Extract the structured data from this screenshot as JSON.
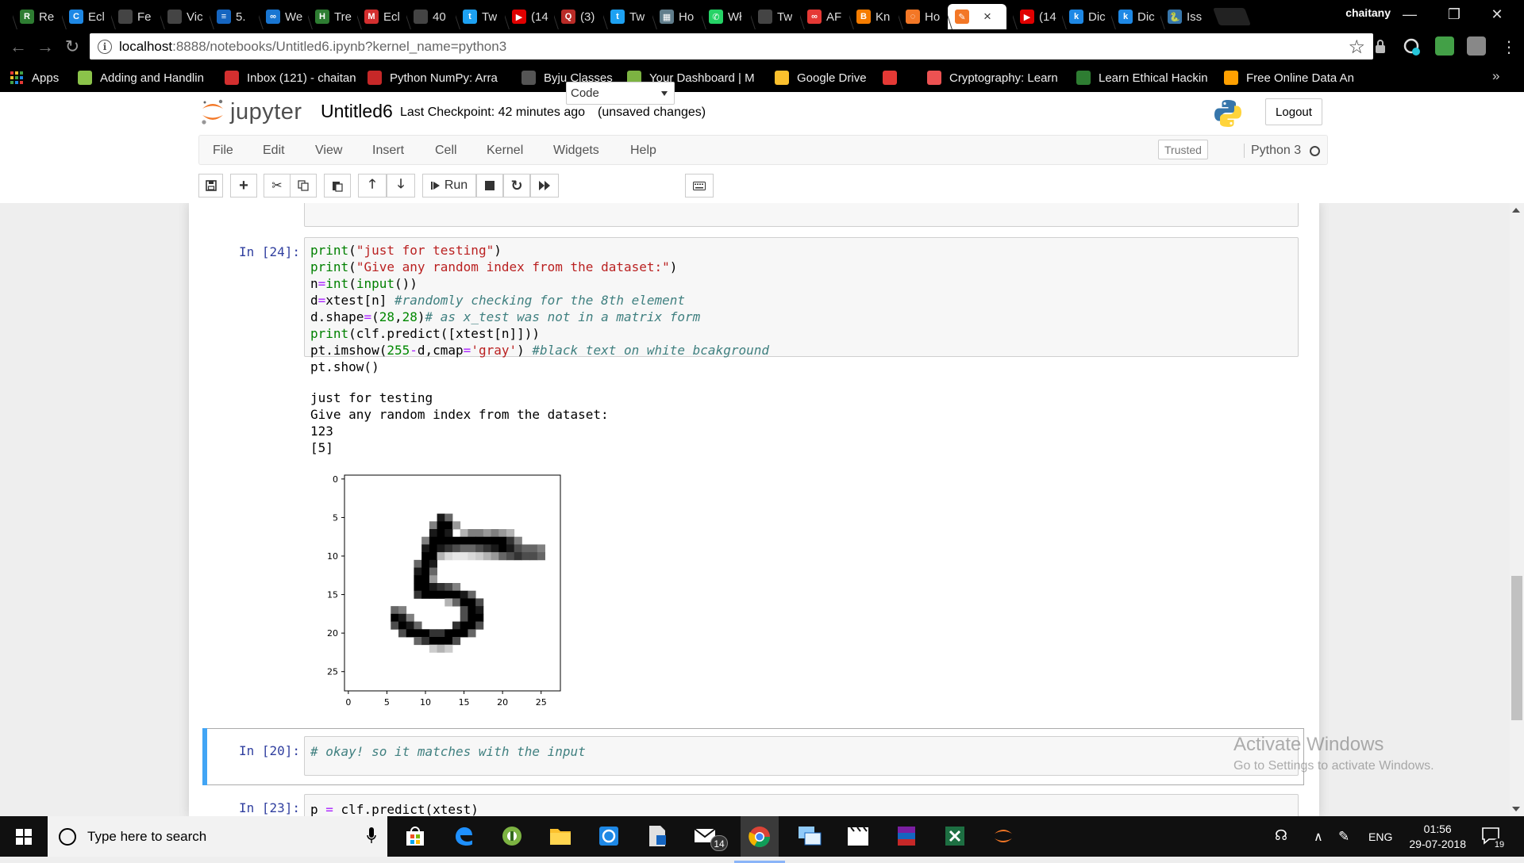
{
  "browser": {
    "tabs": [
      {
        "label": "Re",
        "color": "#2e7d32",
        "glyph": "R"
      },
      {
        "label": "Ecl",
        "color": "#1e88e5",
        "glyph": "C"
      },
      {
        "label": "Fe",
        "color": "#444444",
        "glyph": ""
      },
      {
        "label": "Vic",
        "color": "#444444",
        "glyph": ""
      },
      {
        "label": "5.",
        "color": "#1565c0",
        "glyph": "≡"
      },
      {
        "label": "We",
        "color": "#1976d2",
        "glyph": "∞"
      },
      {
        "label": "Tre",
        "color": "#2e7d32",
        "glyph": "H"
      },
      {
        "label": "Ecl",
        "color": "#d32f2f",
        "glyph": "M"
      },
      {
        "label": "40",
        "color": "#444444",
        "glyph": ""
      },
      {
        "label": "Tw",
        "color": "#1da1f2",
        "glyph": "t"
      },
      {
        "label": "(14",
        "color": "#e00000",
        "glyph": "▶"
      },
      {
        "label": "(3)",
        "color": "#b92b27",
        "glyph": "Q"
      },
      {
        "label": "Tw",
        "color": "#1da1f2",
        "glyph": "t"
      },
      {
        "label": "Ho",
        "color": "#607d8b",
        "glyph": "▦"
      },
      {
        "label": "Wł",
        "color": "#25d366",
        "glyph": "✆"
      },
      {
        "label": "Tw",
        "color": "#444444",
        "glyph": ""
      },
      {
        "label": "AF",
        "color": "#e53935",
        "glyph": "∞"
      },
      {
        "label": "Kn",
        "color": "#f57c00",
        "glyph": "B"
      },
      {
        "label": "Ho",
        "color": "#f37726",
        "glyph": "◌"
      },
      {
        "label": "",
        "color": "#f37726",
        "glyph": "✎",
        "active": true
      },
      {
        "label": "(14",
        "color": "#e00000",
        "glyph": "▶"
      },
      {
        "label": "Dic",
        "color": "#1e88e5",
        "glyph": "k"
      },
      {
        "label": "Dic",
        "color": "#1e88e5",
        "glyph": "k"
      },
      {
        "label": "Iss",
        "color": "#3776ab",
        "glyph": "🐍"
      }
    ],
    "profile_name": "chaitany",
    "url_host": "localhost",
    "url_path": ":8888/notebooks/Untitled6.ipynb?kernel_name=python3",
    "bookmarks": [
      {
        "label": "Apps",
        "icon": "apps-grid-icon",
        "color": "#e53935"
      },
      {
        "label": "Adding and Handlin",
        "icon": "android-icon",
        "color": "#8bc34a"
      },
      {
        "label": "Inbox (121) - chaitan",
        "icon": "gmail-icon",
        "color": "#d32f2f"
      },
      {
        "label": "Python NumPy: Arra",
        "icon": "w3-icon",
        "color": "#c62828"
      },
      {
        "label": "Byju Classes",
        "icon": "byju-icon",
        "color": "#555555"
      },
      {
        "label": "Your Dashboard | M",
        "icon": "dashboard-icon",
        "color": "#7cb342"
      },
      {
        "label": "Google Drive",
        "icon": "drive-icon",
        "color": "#fbc02d"
      },
      {
        "label": "",
        "icon": "bookmark-icon",
        "color": "#e53935"
      },
      {
        "label": "Cryptography: Learn",
        "icon": "udemy-icon",
        "color": "#ec5252"
      },
      {
        "label": "Learn Ethical Hackin",
        "icon": "ftu-icon",
        "color": "#2e7d32"
      },
      {
        "label": "Free Online Data An",
        "icon": "bookmark-icon",
        "color": "#ffa000"
      }
    ]
  },
  "jupyter": {
    "logo_text": "jupyter",
    "notebook_name": "Untitled6",
    "checkpoint": "Last Checkpoint: 42 minutes ago",
    "autosave": "(unsaved changes)",
    "logout": "Logout",
    "menu": [
      "File",
      "Edit",
      "View",
      "Insert",
      "Cell",
      "Kernel",
      "Widgets",
      "Help"
    ],
    "trusted": "Trusted",
    "kernel": "Python 3",
    "run_label": "Run",
    "cell_type": "Code"
  },
  "cells": [
    {
      "prompt": "In [24]:",
      "source": [
        "print(\"just for testing\")",
        "print(\"Give any random index from the dataset:\")",
        "n=int(input())",
        "d=xtest[n] #randomly checking for the 8th element",
        "d.shape=(28,28)# as x_test was not in a matrix form",
        "print(clf.predict([xtest[n]]))",
        "pt.imshow(255-d,cmap='gray') #black text on white bcakground",
        "pt.show()"
      ],
      "output": [
        "just for testing",
        "Give any random index from the dataset:",
        "123",
        "[5]"
      ]
    },
    {
      "prompt": "In [20]:",
      "source": [
        "# okay! so it matches with the input"
      ]
    },
    {
      "prompt": "In [23]:",
      "source": [
        "p = clf.predict(xtest)"
      ]
    }
  ],
  "chart_data": {
    "type": "heatmap",
    "title": "",
    "xlabel": "",
    "ylabel": "",
    "xticks": [
      "0",
      "5",
      "10",
      "15",
      "20",
      "25"
    ],
    "yticks": [
      "0",
      "5",
      "10",
      "15",
      "20",
      "25"
    ],
    "xlim": [
      -0.5,
      27.5
    ],
    "ylim": [
      27.5,
      -0.5
    ],
    "colormap": "gray",
    "description_value": "28x28 grayscale digit image",
    "ink_pixels": [
      [
        5,
        12,
        0.9
      ],
      [
        5,
        13,
        0.6
      ],
      [
        6,
        11,
        0.5
      ],
      [
        6,
        12,
        1
      ],
      [
        6,
        13,
        1
      ],
      [
        6,
        14,
        0.4
      ],
      [
        7,
        11,
        0.9
      ],
      [
        7,
        12,
        1
      ],
      [
        7,
        13,
        0.9
      ],
      [
        7,
        15,
        0.3
      ],
      [
        7,
        16,
        0.5
      ],
      [
        7,
        17,
        0.5
      ],
      [
        7,
        18,
        0.4
      ],
      [
        7,
        19,
        0.5
      ],
      [
        7,
        20,
        0.4
      ],
      [
        7,
        21,
        0.3
      ],
      [
        8,
        10,
        0.5
      ],
      [
        8,
        11,
        1
      ],
      [
        8,
        12,
        1
      ],
      [
        8,
        13,
        1
      ],
      [
        8,
        14,
        1
      ],
      [
        8,
        15,
        1
      ],
      [
        8,
        16,
        1
      ],
      [
        8,
        17,
        1
      ],
      [
        8,
        18,
        1
      ],
      [
        8,
        19,
        1
      ],
      [
        8,
        20,
        1
      ],
      [
        8,
        21,
        0.8
      ],
      [
        8,
        22,
        0.5
      ],
      [
        9,
        10,
        0.9
      ],
      [
        9,
        11,
        1
      ],
      [
        9,
        12,
        0.9
      ],
      [
        9,
        13,
        0.8
      ],
      [
        9,
        14,
        0.7
      ],
      [
        9,
        15,
        0.6
      ],
      [
        9,
        16,
        0.6
      ],
      [
        9,
        17,
        0.7
      ],
      [
        9,
        18,
        0.8
      ],
      [
        9,
        19,
        0.9
      ],
      [
        9,
        20,
        1
      ],
      [
        9,
        21,
        0.9
      ],
      [
        9,
        22,
        0.7
      ],
      [
        9,
        23,
        0.6
      ],
      [
        9,
        24,
        0.6
      ],
      [
        9,
        25,
        0.5
      ],
      [
        10,
        10,
        1
      ],
      [
        10,
        11,
        1
      ],
      [
        10,
        12,
        0.3
      ],
      [
        10,
        13,
        0.15
      ],
      [
        10,
        14,
        0.1
      ],
      [
        10,
        15,
        0.1
      ],
      [
        10,
        16,
        0.15
      ],
      [
        10,
        17,
        0.2
      ],
      [
        10,
        18,
        0.3
      ],
      [
        10,
        19,
        0.4
      ],
      [
        10,
        20,
        0.6
      ],
      [
        10,
        21,
        0.7
      ],
      [
        10,
        22,
        0.8
      ],
      [
        10,
        23,
        0.7
      ],
      [
        10,
        24,
        0.7
      ],
      [
        10,
        25,
        0.6
      ],
      [
        11,
        9,
        0.6
      ],
      [
        11,
        10,
        1
      ],
      [
        11,
        11,
        0.9
      ],
      [
        12,
        9,
        0.9
      ],
      [
        12,
        10,
        1
      ],
      [
        12,
        11,
        0.6
      ],
      [
        13,
        9,
        1
      ],
      [
        13,
        10,
        1
      ],
      [
        13,
        11,
        0.4
      ],
      [
        14,
        9,
        1
      ],
      [
        14,
        10,
        1
      ],
      [
        14,
        11,
        0.9
      ],
      [
        14,
        12,
        0.8
      ],
      [
        14,
        13,
        0.7
      ],
      [
        14,
        14,
        0.5
      ],
      [
        15,
        9,
        0.8
      ],
      [
        15,
        10,
        1
      ],
      [
        15,
        11,
        1
      ],
      [
        15,
        12,
        1
      ],
      [
        15,
        13,
        1
      ],
      [
        15,
        14,
        1
      ],
      [
        15,
        15,
        0.9
      ],
      [
        15,
        16,
        0.6
      ],
      [
        16,
        13,
        0.3
      ],
      [
        16,
        14,
        0.6
      ],
      [
        16,
        15,
        1
      ],
      [
        16,
        16,
        1
      ],
      [
        16,
        17,
        0.7
      ],
      [
        17,
        6,
        0.6
      ],
      [
        17,
        7,
        0.5
      ],
      [
        17,
        15,
        0.7
      ],
      [
        17,
        16,
        1
      ],
      [
        17,
        17,
        0.9
      ],
      [
        18,
        6,
        1
      ],
      [
        18,
        7,
        0.9
      ],
      [
        18,
        8,
        0.5
      ],
      [
        18,
        15,
        0.7
      ],
      [
        18,
        16,
        1
      ],
      [
        18,
        17,
        1
      ],
      [
        19,
        6,
        0.7
      ],
      [
        19,
        7,
        1
      ],
      [
        19,
        8,
        0.9
      ],
      [
        19,
        9,
        0.6
      ],
      [
        19,
        14,
        0.8
      ],
      [
        19,
        15,
        1
      ],
      [
        19,
        16,
        1
      ],
      [
        19,
        17,
        0.7
      ],
      [
        20,
        7,
        0.7
      ],
      [
        20,
        8,
        1
      ],
      [
        20,
        9,
        1
      ],
      [
        20,
        10,
        1
      ],
      [
        20,
        11,
        0.8
      ],
      [
        20,
        12,
        0.8
      ],
      [
        20,
        13,
        1
      ],
      [
        20,
        14,
        1
      ],
      [
        20,
        15,
        1
      ],
      [
        20,
        16,
        0.6
      ],
      [
        21,
        9,
        0.6
      ],
      [
        21,
        10,
        0.8
      ],
      [
        21,
        11,
        1
      ],
      [
        21,
        12,
        1
      ],
      [
        21,
        13,
        1
      ],
      [
        21,
        14,
        0.7
      ],
      [
        22,
        11,
        0.2
      ],
      [
        22,
        12,
        0.3
      ],
      [
        22,
        13,
        0.2
      ]
    ]
  },
  "watermark": {
    "line1": "Activate Windows",
    "line2": "Go to Settings to activate Windows."
  },
  "taskbar": {
    "search_placeholder": "Type here to search",
    "mail_badge": "14",
    "language": "ENG",
    "time": "01:56",
    "date": "29-07-2018",
    "notification_count": "19"
  }
}
